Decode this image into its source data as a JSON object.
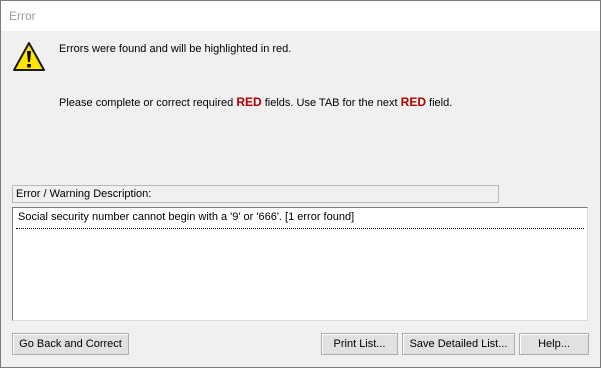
{
  "window": {
    "title": "Error"
  },
  "message": {
    "line1": "Errors were found and will be highlighted in red.",
    "line2_before": "Please complete or correct required ",
    "red_word_1": "RED",
    "line2_middle": " fields. Use TAB for the next ",
    "red_word_2": "RED",
    "line2_after": " field.",
    "icon": "warning-icon"
  },
  "errors": {
    "header": "Error / Warning Description:",
    "items": [
      "Social security number cannot begin with a '9' or '666'. [1 error found]"
    ]
  },
  "buttons": {
    "go_back": "Go Back and Correct",
    "print_list": "Print List...",
    "save_detailed": "Save Detailed List...",
    "help": "Help..."
  },
  "colors": {
    "highlight_red": "#b00000",
    "dialog_bg": "#f0f0f0",
    "warning_yellow": "#ffe600"
  }
}
